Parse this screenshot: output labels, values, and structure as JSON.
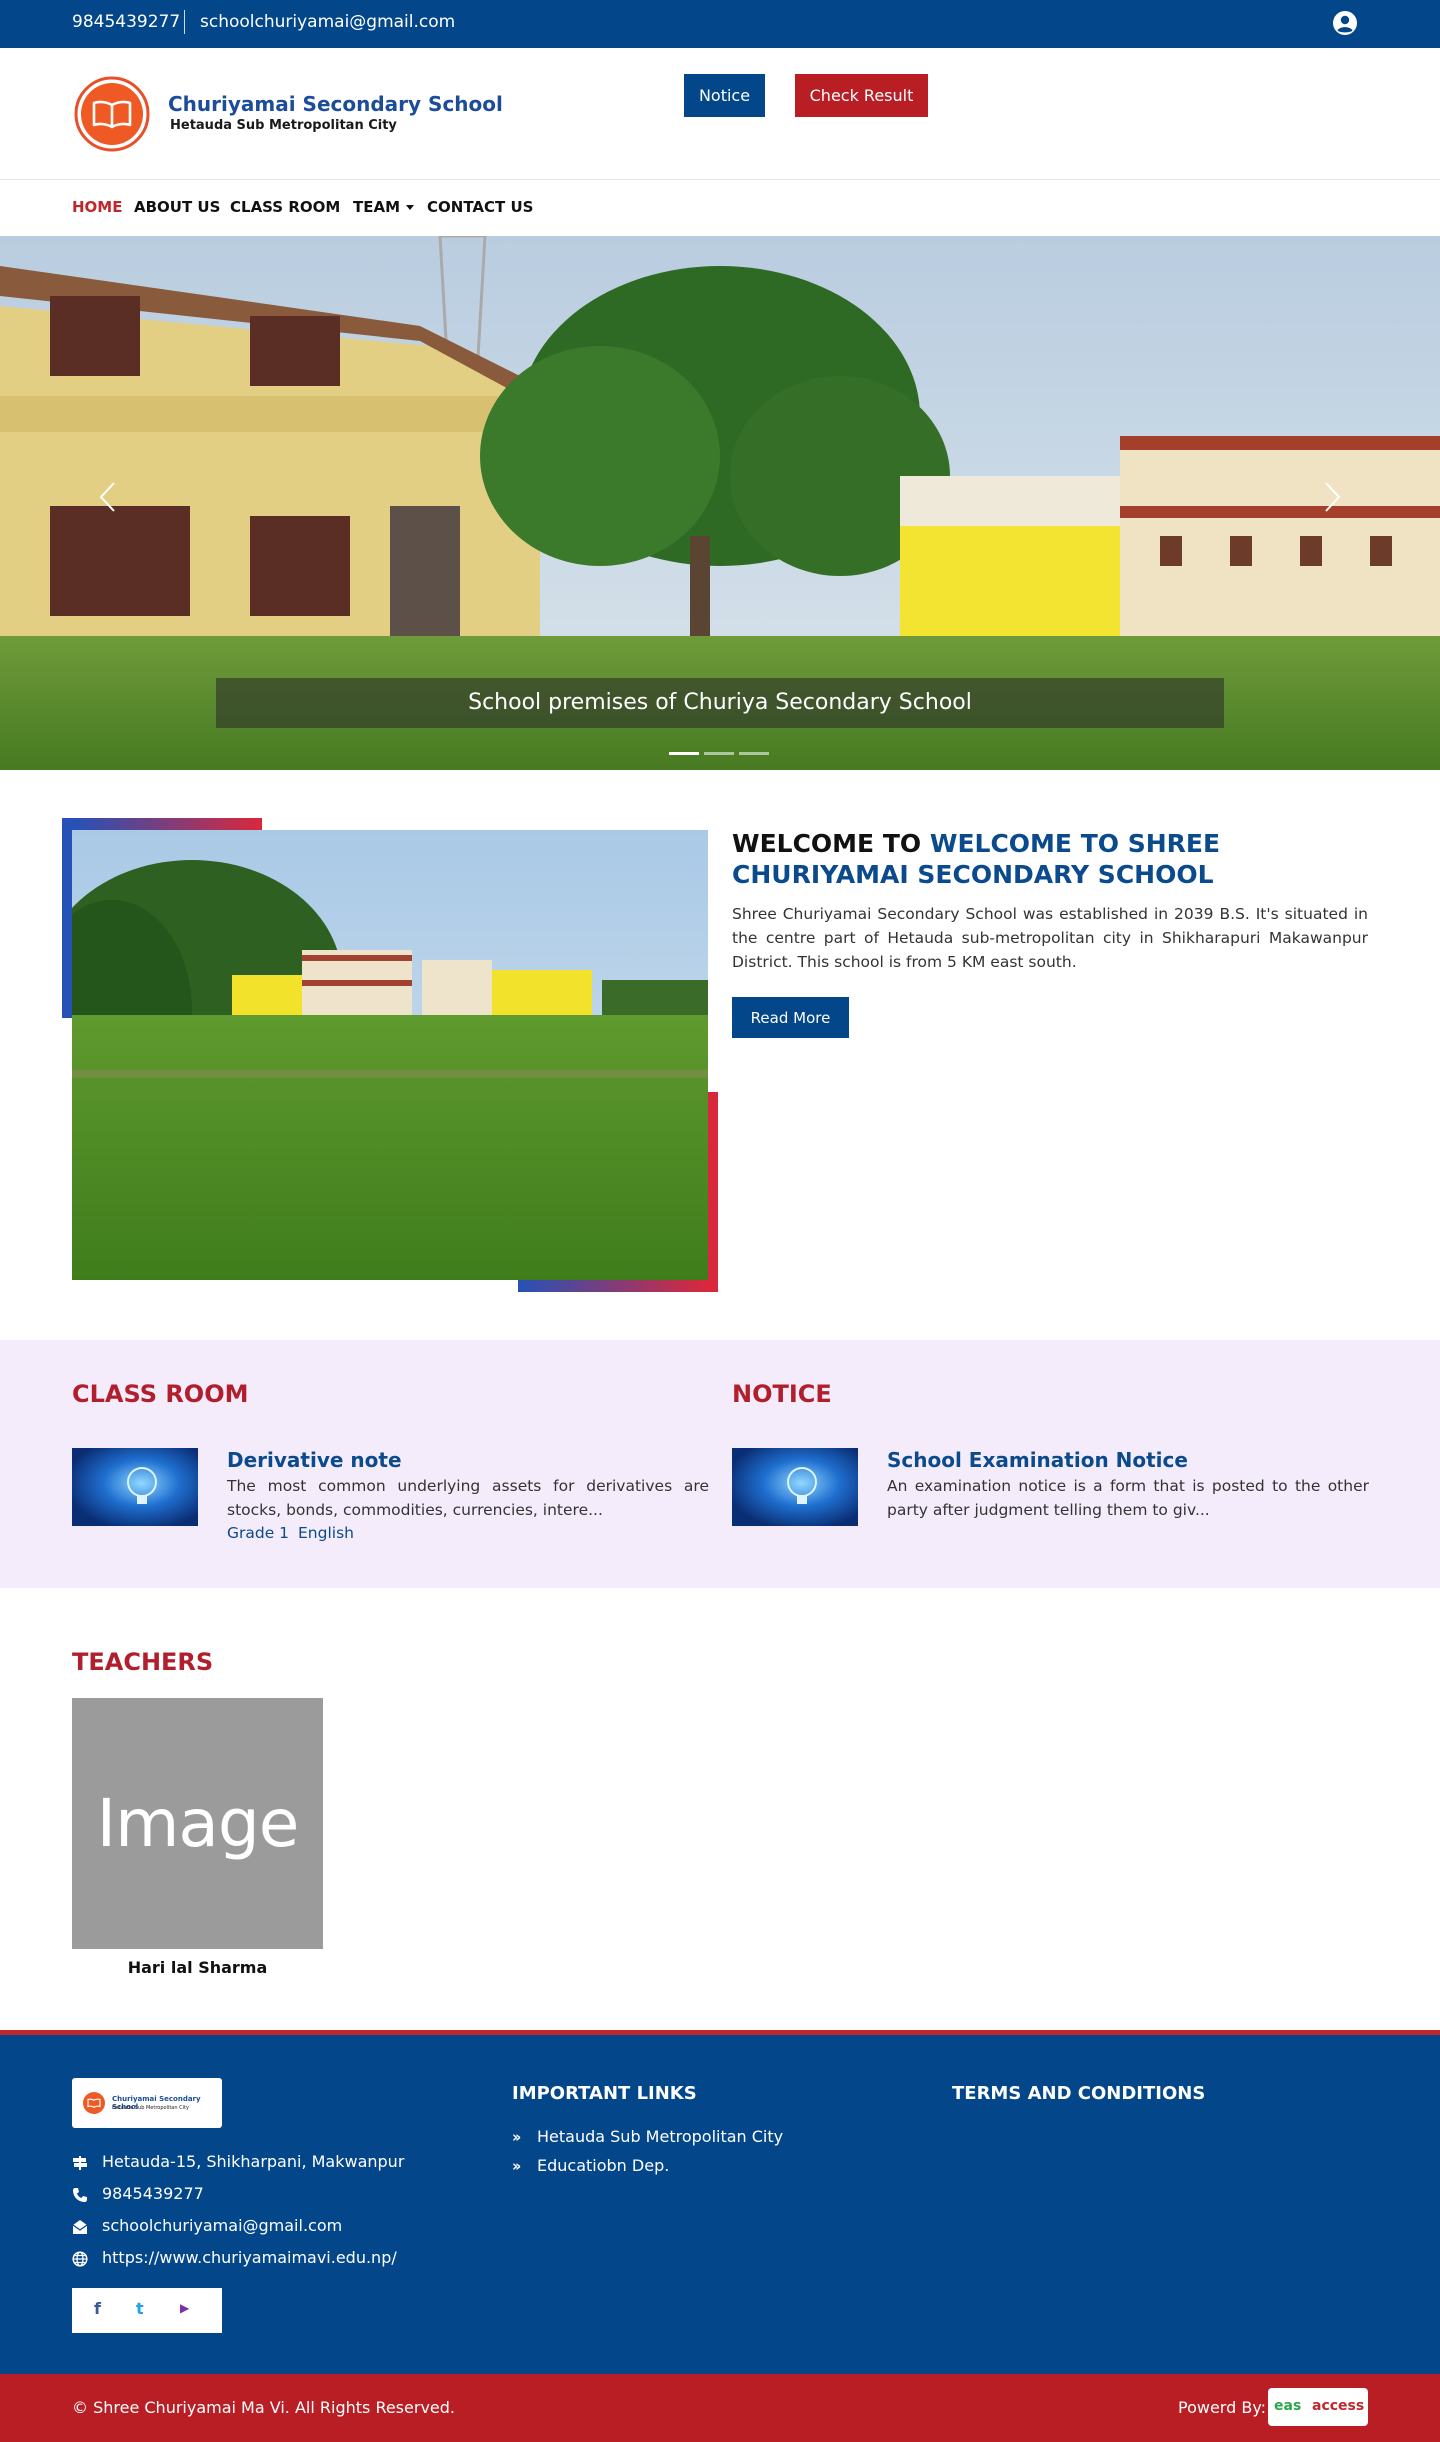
{
  "topbar": {
    "phone": "9845439277",
    "email": "schoolchuriyamai@gmail.com",
    "user_icon": "user-circle-icon"
  },
  "header": {
    "school_name": "Churiyamai Secondary School",
    "school_subtitle": "Hetauda Sub Metropolitan City",
    "notice_button": "Notice",
    "result_button": "Check Result",
    "logo_icon": "open-book-icon",
    "brand_color": "#03468a",
    "accent_color": "#b81e24"
  },
  "nav": {
    "items": [
      {
        "label": "HOME",
        "active": true
      },
      {
        "label": "ABOUT US",
        "active": false
      },
      {
        "label": "CLASS ROOM",
        "active": false
      },
      {
        "label": "TEAM",
        "active": false
      },
      {
        "label": "CONTACT US",
        "active": false
      }
    ]
  },
  "hero": {
    "caption": "School premises of Churiya Secondary School",
    "slide_count": 3,
    "active_slide": 1
  },
  "welcome": {
    "title_plain": "WELCOME TO",
    "title_accent": "WELCOME TO SHREE CHURIYAMAI SECONDARY SCHOOL",
    "text": "Shree Churiyamai Secondary School was established in 2039 B.S. It's situated in the centre part of Hetauda sub-metropolitan city in Shikharapuri Makawanpur District. This school is from 5 KM east south.",
    "button": "Read More"
  },
  "classroom": {
    "title": "CLASS ROOM",
    "item": {
      "title": "Derivative note",
      "text": "The most common underlying assets for derivatives are stocks, bonds, commodities, currencies, intere...",
      "grade": "Grade 1",
      "subject": "English"
    }
  },
  "notice": {
    "title": "NOTICE",
    "item": {
      "title": "School Examination Notice",
      "text": "An examination notice is a form that is posted to the other party after judgment telling them to giv..."
    }
  },
  "teachers": {
    "title": "TEACHERS",
    "items": [
      {
        "placeholder": "Image",
        "name": "Hari lal Sharma"
      }
    ]
  },
  "footer": {
    "logo_name": "Churiyamai Secondary School",
    "logo_sub": "Hetauda Sub Metropolitan City",
    "address": "Hetauda-15, Shikharpani, Makwanpur",
    "phone": "9845439277",
    "email": "schoolchuriyamai@gmail.com",
    "website": "https://www.churiyamaimavi.edu.np/",
    "important_links_title": "IMPORTANT LINKS",
    "links": [
      "Hetauda Sub Metropolitan City",
      "Educatiobn Dep."
    ],
    "terms_title": "TERMS AND CONDITIONS",
    "social": {
      "facebook": "f",
      "twitter": "t",
      "youtube": "▶"
    },
    "copyright": "© Shree Churiyamai Ma Vi. All Rights Reserved.",
    "powered_by": "Powerd By:",
    "powered_logo_a": "eas",
    "powered_logo_b": "access"
  }
}
